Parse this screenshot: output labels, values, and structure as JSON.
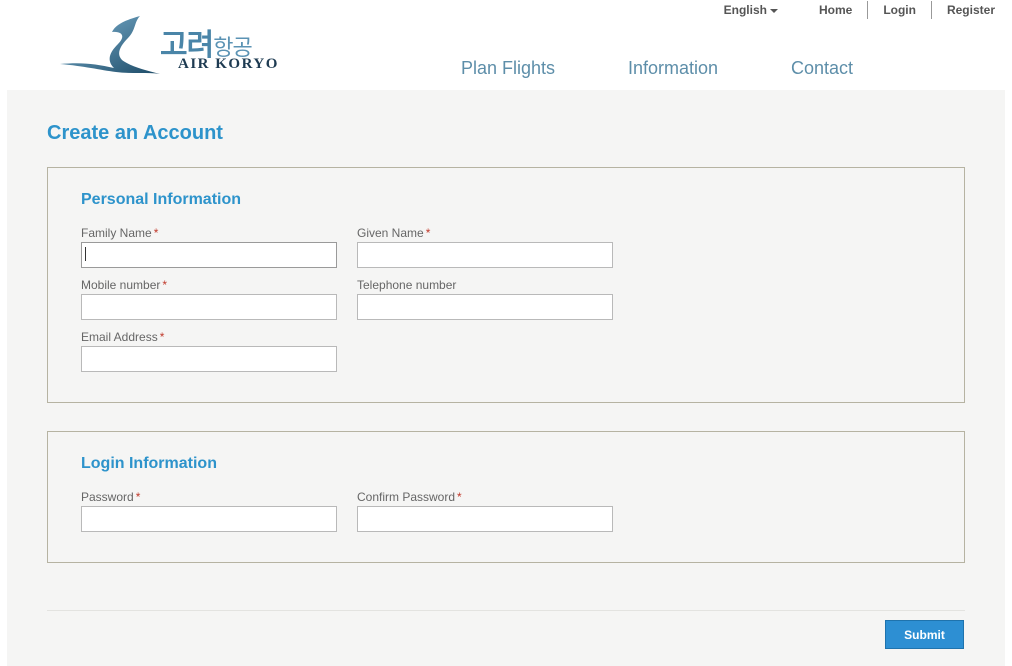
{
  "header": {
    "logo": {
      "korean_main": "고려",
      "korean_sub": "항공",
      "english": "AIR KORYO"
    },
    "language": "English",
    "top_links": [
      "Home",
      "Login",
      "Register"
    ],
    "nav": [
      "Plan Flights",
      "Information",
      "Contact"
    ]
  },
  "page": {
    "title": "Create an Account"
  },
  "personal": {
    "title": "Personal Information",
    "family_name": {
      "label": "Family Name",
      "required": "*",
      "value": ""
    },
    "given_name": {
      "label": "Given Name",
      "required": "*",
      "value": ""
    },
    "mobile": {
      "label": "Mobile number",
      "required": "*",
      "value": ""
    },
    "telephone": {
      "label": "Telephone number",
      "value": ""
    },
    "email": {
      "label": "Email Address",
      "required": "*",
      "value": ""
    }
  },
  "login": {
    "title": "Login Information",
    "password": {
      "label": "Password",
      "required": "*",
      "value": ""
    },
    "confirm_password": {
      "label": "Confirm Password",
      "required": "*",
      "value": ""
    }
  },
  "actions": {
    "submit_label": "Submit"
  },
  "colors": {
    "accent": "#2d93cb",
    "nav": "#5d8ea9",
    "required": "#c0392b",
    "panel_bg": "#f5f5f4",
    "submit_bg": "#2d8fd3"
  }
}
